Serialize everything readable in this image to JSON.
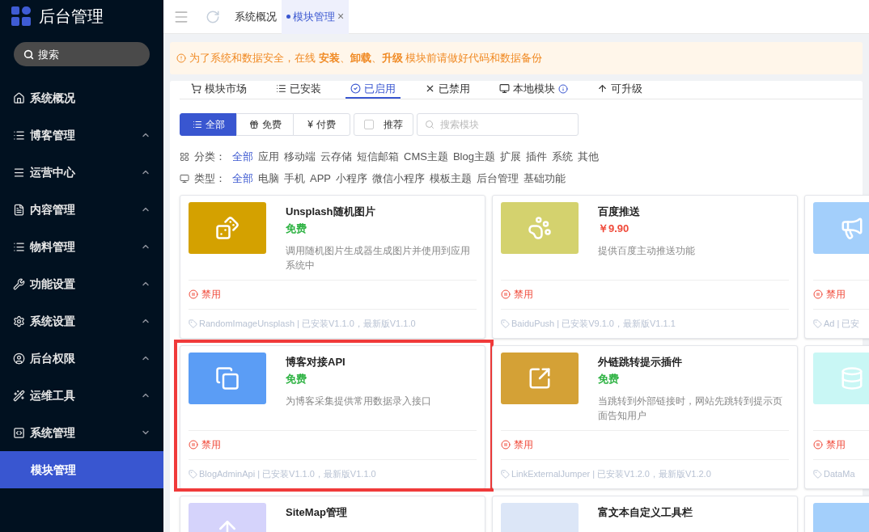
{
  "app": {
    "title": "后台管理",
    "search": {
      "placeholder": "搜索"
    }
  },
  "sidebar": {
    "items": [
      {
        "label": "系统概况",
        "selected": false
      },
      {
        "label": "博客管理",
        "selected": false,
        "expanded": false
      },
      {
        "label": "运营中心",
        "selected": false,
        "expanded": false
      },
      {
        "label": "内容管理",
        "selected": false,
        "expanded": false
      },
      {
        "label": "物料管理",
        "selected": false,
        "expanded": false
      },
      {
        "label": "功能设置",
        "selected": false,
        "expanded": false
      },
      {
        "label": "系统设置",
        "selected": false,
        "expanded": false
      },
      {
        "label": "后台权限",
        "selected": false,
        "expanded": false
      },
      {
        "label": "运维工具",
        "selected": false,
        "expanded": false
      },
      {
        "label": "系统管理",
        "selected": false,
        "expanded": true,
        "children": [
          {
            "label": "模块管理",
            "selected": true
          }
        ]
      }
    ]
  },
  "page_tabs": [
    {
      "label": "系统概况",
      "selected": false
    },
    {
      "label": "模块管理",
      "selected": true,
      "close": "×"
    }
  ],
  "alert": {
    "text": "为了系统和数据安全，在线 **安装**、**卸载**、**升级** 模块前请做好代码和数据备份"
  },
  "module_tabs": [
    {
      "kind": "plain",
      "label": "模块市场",
      "selected": false
    },
    {
      "kind": "plain",
      "label": "已安装",
      "selected": false
    },
    {
      "kind": "plain",
      "label": "已启用",
      "selected": true
    },
    {
      "kind": "plain",
      "label": "已禁用",
      "selected": false
    },
    {
      "kind": "info",
      "label": "本地模块",
      "selected": false
    },
    {
      "kind": "plain",
      "label": "可升级",
      "selected": false
    }
  ],
  "price_filter": [
    {
      "label": "全部",
      "selected": true
    },
    {
      "label": "免费",
      "selected": false
    },
    {
      "icon_char": "¥",
      "label": "付费",
      "selected": false
    }
  ],
  "recommend": {
    "label": "推荐",
    "checked": false
  },
  "module_search": {
    "placeholder": "搜索模块"
  },
  "filters": [
    {
      "label": "分类：",
      "options": [
        {
          "label": "全部",
          "selected": true
        },
        {
          "label": "应用",
          "selected": false
        },
        {
          "label": "移动端",
          "selected": false
        },
        {
          "label": "云存储",
          "selected": false
        },
        {
          "label": "短信邮箱",
          "selected": false
        },
        {
          "label": "CMS主题",
          "selected": false
        },
        {
          "label": "Blog主题",
          "selected": false
        },
        {
          "label": "扩展",
          "selected": false
        },
        {
          "label": "插件",
          "selected": false
        },
        {
          "label": "系统",
          "selected": false
        },
        {
          "label": "其他",
          "selected": false
        }
      ]
    },
    {
      "label": "类型：",
      "options": [
        {
          "label": "全部",
          "selected": true
        },
        {
          "label": "电脑",
          "selected": false
        },
        {
          "label": "手机",
          "selected": false
        },
        {
          "label": "APP",
          "selected": false
        },
        {
          "label": "小程序",
          "selected": false
        },
        {
          "label": "微信小程序",
          "selected": false
        },
        {
          "label": "模板主题",
          "selected": false
        },
        {
          "label": "后台管理",
          "selected": false
        },
        {
          "label": "基础功能",
          "selected": false
        }
      ]
    }
  ],
  "modules": [
    {
      "color": "#d4a100",
      "title": "Unsplash随机图片",
      "price": {
        "text": "免费",
        "color": "#2fb344"
      },
      "description": "调用随机图片生成器生成图片并使用到应用系统中",
      "status": "禁用",
      "footer": "RandomImageUnsplash | 已安装V1.1.0，最新版V1.1.0",
      "highlighted": false
    },
    {
      "color": "#d4d26e",
      "title": "百度推送",
      "price": {
        "text": "￥9.90",
        "color": "#f04a3a"
      },
      "description": "提供百度主动推送功能",
      "status": "禁用",
      "footer": "BaiduPush | 已安装V9.1.0，最新版V1.1.1",
      "highlighted": false
    },
    {
      "color": "#a3cffb",
      "status": "禁用",
      "footer": "Ad | 已安",
      "highlighted": false
    },
    {
      "color": "#5b9df5",
      "title": "博客对接API",
      "price": {
        "text": "免费",
        "color": "#2fb344"
      },
      "description": "为博客采集提供常用数据录入接口",
      "status": "禁用",
      "footer": "BlogAdminApi | 已安装V1.1.0，最新版V1.1.0",
      "highlighted": true
    },
    {
      "color": "#d4a136",
      "title": "外链跳转提示插件",
      "price": {
        "text": "免费",
        "color": "#2fb344"
      },
      "description": "当跳转到外部链接时，网站先跳转到提示页面告知用户",
      "status": "禁用",
      "footer": "LinkExternalJumper | 已安装V1.2.0，最新版V1.2.0",
      "highlighted": false
    },
    {
      "color": "#c9f7f5",
      "status": "禁用",
      "footer": "DataMa",
      "highlighted": false
    },
    {
      "color": "#d5d3fb",
      "title": "SiteMap管理",
      "highlighted": false
    },
    {
      "color": "#dce6f7",
      "title": "富文本自定义工具栏",
      "highlighted": false
    },
    {
      "color": "#a3cffb",
      "highlighted": false
    }
  ]
}
